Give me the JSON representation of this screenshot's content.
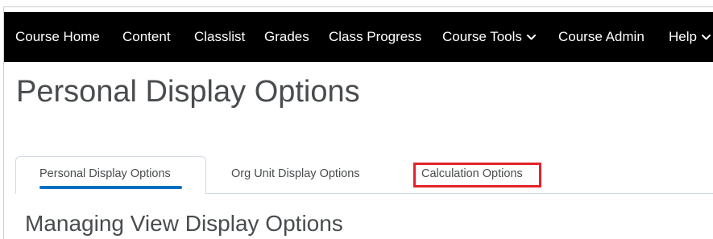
{
  "navbar": {
    "items": [
      {
        "label": "Course Home"
      },
      {
        "label": "Content"
      },
      {
        "label": "Classlist"
      },
      {
        "label": "Grades"
      },
      {
        "label": "Class Progress"
      },
      {
        "label": "Course Tools",
        "icon": "chevron-down-icon"
      },
      {
        "label": "Course Admin"
      },
      {
        "label": "Help",
        "icon": "chevron-down-icon"
      }
    ]
  },
  "page": {
    "title": "Personal Display Options"
  },
  "tabs": [
    {
      "label": "Personal Display Options",
      "active": true
    },
    {
      "label": "Org Unit Display Options",
      "active": false
    },
    {
      "label": "Calculation Options",
      "active": false,
      "highlighted": true
    }
  ],
  "section": {
    "title": "Managing View Display Options"
  },
  "colors": {
    "navbar_bg": "#000000",
    "navbar_text": "#ffffff",
    "text": "#494c4e",
    "active_tab_indicator": "#006fbf",
    "highlight_border": "#e2232a",
    "tab_border": "#d3d9e3"
  }
}
